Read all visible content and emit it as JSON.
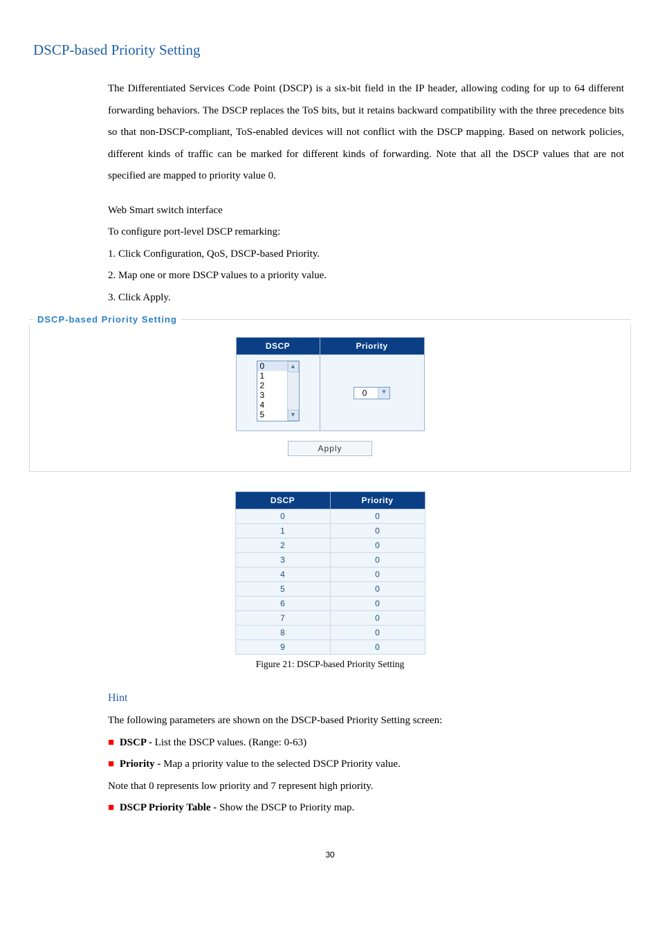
{
  "section_title": "DSCP-based Priority Setting",
  "intro_para": "The Differentiated Services Code Point (DSCP) is a six-bit field in the IP header, allowing coding for up to 64 different forwarding behaviors. The DSCP replaces the ToS bits, but it retains backward compatibility with the three precedence bits so that non-DSCP-compliant, ToS-enabled devices will not conflict with the DSCP mapping. Based on network policies, different kinds of traffic can be marked for different kinds of forwarding. Note that all the DSCP values that are not specified are mapped to priority value 0.",
  "iface_label": "Web Smart switch interface",
  "configure_label": "To configure port-level DSCP remarking:",
  "steps": {
    "s1": "1. Click Configuration, QoS, DSCP-based Priority.",
    "s2": "2. Map one or more DSCP values to a priority value.",
    "s3": "3. Click Apply."
  },
  "panel_legend": "DSCP-based Priority Setting",
  "headers": {
    "dscp": "DSCP",
    "priority": "Priority"
  },
  "dscp_list_visible": [
    "0",
    "1",
    "2",
    "3",
    "4",
    "5"
  ],
  "priority_selected": "0",
  "apply_label": "Apply",
  "result_rows": [
    {
      "dscp": "0",
      "prio": "0"
    },
    {
      "dscp": "1",
      "prio": "0"
    },
    {
      "dscp": "2",
      "prio": "0"
    },
    {
      "dscp": "3",
      "prio": "0"
    },
    {
      "dscp": "4",
      "prio": "0"
    },
    {
      "dscp": "5",
      "prio": "0"
    },
    {
      "dscp": "6",
      "prio": "0"
    },
    {
      "dscp": "7",
      "prio": "0"
    },
    {
      "dscp": "8",
      "prio": "0"
    },
    {
      "dscp": "9",
      "prio": "0"
    }
  ],
  "figure_caption": "Figure 21: DSCP-based Priority Setting",
  "hint_title": "Hint",
  "hint_intro": "The following parameters are shown on the DSCP-based Priority Setting screen:",
  "hint_items": {
    "i1_bold": "DSCP - ",
    "i1_rest": "List the DSCP values. (Range: 0-63)",
    "i2_bold": "Priority - ",
    "i2_rest": "Map a priority value to the selected DSCP Priority value.",
    "note": "Note that 0 represents low priority and 7 represent high priority.",
    "i3_bold": "DSCP Priority Table - ",
    "i3_rest": "Show the DSCP to Priority map."
  },
  "page_number": "30"
}
